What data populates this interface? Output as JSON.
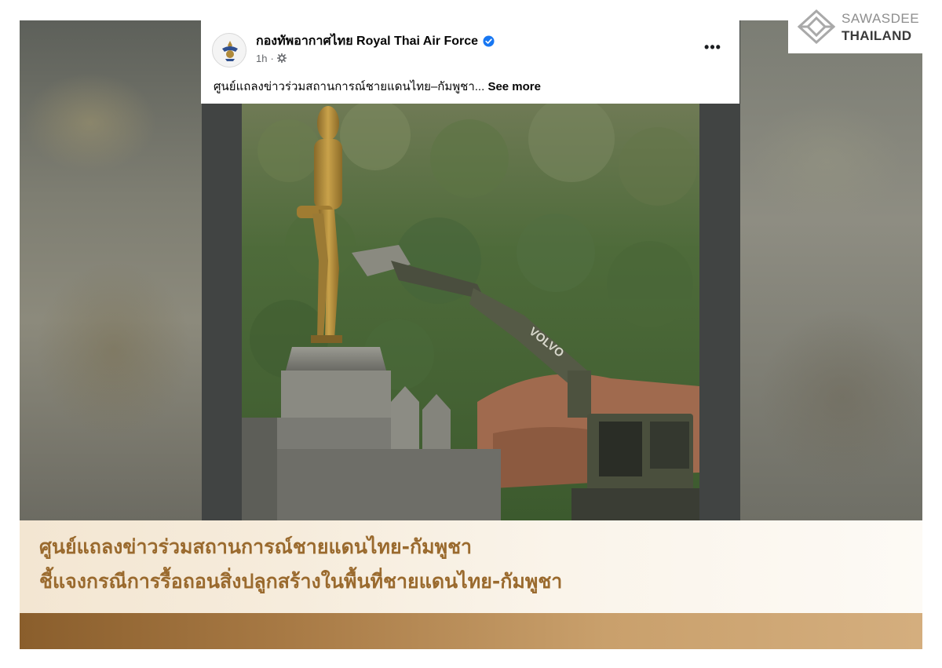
{
  "post": {
    "author": "กองทัพอากาศไทย Royal Thai Air Force",
    "time": "1h",
    "text": "ศูนย์แถลงข่าวร่วมสถานการณ์ชายแดนไทย–กัมพูชา...",
    "see_more": "See more",
    "more_menu": "•••",
    "photo_text": "VOLVO"
  },
  "brand": {
    "line1": "SAWASDEE",
    "line2": "THAILAND"
  },
  "headline": {
    "line1": "ศูนย์แถลงข่าวร่วมสถานการณ์ชายแดนไทย-กัมพูชา",
    "line2": "ชี้แจงกรณีการรื้อถอนสิ่งปลูกสร้างในพื้นที่ชายแดนไทย-กัมพูชา"
  },
  "colors": {
    "headline_text": "#9a6a2e",
    "verified": "#1877f2",
    "gold_bar": "#a87a45"
  },
  "icons": [
    "rtaf-emblem-icon",
    "verified-badge-icon",
    "globe-gear-icon",
    "more-options-icon",
    "sawasdee-diamond-icon"
  ]
}
